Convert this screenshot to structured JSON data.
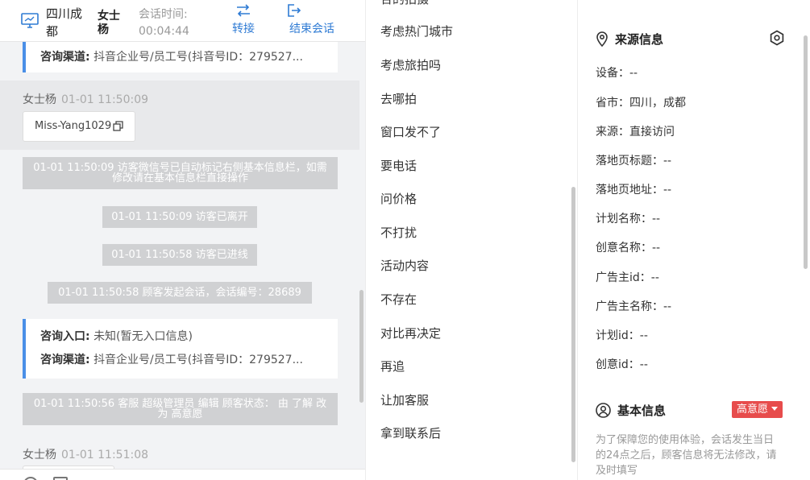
{
  "chat": {
    "header": {
      "location": "四川成都",
      "visitor_name": "女士杨",
      "time_label": "会话时间:",
      "time_value": "00:04:44",
      "transfer_label": "转接",
      "end_label": "结束会话"
    },
    "info_card_top": {
      "channel_label": "咨询渠道:",
      "channel_value": "抖音企业号/员工号(抖音号ID：279527..."
    },
    "visitor_msg_1": {
      "name": "女士杨",
      "time": "01-01 11:50:09",
      "wechat_chip": "Miss-Yang1029"
    },
    "system_messages": [
      "01-01 11:50:09 访客微信号已自动标记右侧基本信息栏，如需修改请在基本信息栏直接操作",
      "01-01 11:50:09 访客已离开",
      "01-01 11:50:58 访客已进线",
      "01-01 11:50:58 顾客发起会话，会话编号：28689"
    ],
    "info_card_bottom": {
      "entry_label": "咨询入口:",
      "entry_value": "未知(暂无入口信息)",
      "channel_label": "咨询渠道:",
      "channel_value": "抖音企业号/员工号(抖音号ID：279527..."
    },
    "status_change_message": "01-01 11:50:56 客服 超级管理员 编辑 顾客状态： 由 了解 改为 高意愿",
    "visitor_msg_2": {
      "name": "女士杨",
      "time": "01-01 11:51:08"
    }
  },
  "quick_replies": [
    "考虑热门城市",
    "考虑旅拍吗",
    "去哪拍",
    "窗口发不了",
    "要电话",
    "问价格",
    "不打扰",
    "活动内容",
    "不存在",
    "对比再决定",
    "再追",
    "让加客服",
    "拿到联系后"
  ],
  "source_info": {
    "title": "来源信息",
    "fields": [
      "设备：--",
      "省市：四川，成都",
      "来源：直接访问",
      "落地页标题：--",
      "落地页地址：--",
      "计划名称：--",
      "创意名称：--",
      "广告主id：--",
      "广告主名称：--",
      "计划id：--",
      "创意id：--"
    ]
  },
  "basic_info": {
    "title": "基本信息",
    "intent_badge": "高意愿",
    "notice": "为了保障您的使用体验，会话发生当日的24点之后，顾客信息将无法修改，请及时填写"
  },
  "colors": {
    "accent_blue": "#2f7bd4",
    "card_border": "#4a8fe7",
    "badge_red": "#e74c4c"
  },
  "icons": [
    "monitor-icon",
    "transfer-icon",
    "exit-icon",
    "copy-icon",
    "location-pin-icon",
    "settings-icon",
    "user-circle-icon"
  ]
}
